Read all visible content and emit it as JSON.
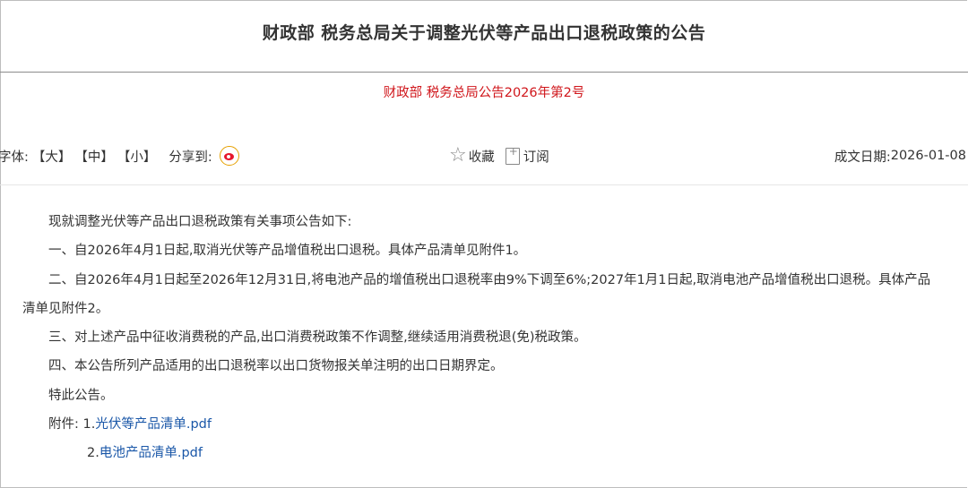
{
  "title": "财政部 税务总局关于调整光伏等产品出口退税政策的公告",
  "doc_number": "财政部 税务总局公告2026年第2号",
  "toolbar": {
    "font_label": "字体:",
    "font_large": "【大】",
    "font_medium": "【中】",
    "font_small": "【小】",
    "share_label": "分享到:",
    "share_icon": "weibo-icon",
    "favorite_label": "收藏",
    "subscribe_label": "订阅",
    "date_label": "成文日期:",
    "date_value": "2026-01-08"
  },
  "body": {
    "intro": "现就调整光伏等产品出口退税政策有关事项公告如下:",
    "item1": "一、自2026年4月1日起,取消光伏等产品增值税出口退税。具体产品清单见附件1。",
    "item2_line1": "二、自2026年4月1日起至2026年12月31日,将电池产品的增值税出口退税率由9%下调至6%;2027年1月1日起,取消电池产品增值税出口退税。具体产品",
    "item2_line2": "清单见附件2。",
    "item3": "三、对上述产品中征收消费税的产品,出口消费税政策不作调整,继续适用消费税退(免)税政策。",
    "item4": "四、本公告所列产品适用的出口退税率以出口货物报关单注明的出口日期界定。",
    "closing": "特此公告。",
    "attachments_label": "附件:",
    "attachment1_index": "1.",
    "attachment1": "光伏等产品清单.pdf",
    "attachment2_index": "2.",
    "attachment2": "电池产品清单.pdf"
  },
  "colors": {
    "doc_number": "#d0161b",
    "link": "#1a57a8",
    "text": "#333333"
  }
}
